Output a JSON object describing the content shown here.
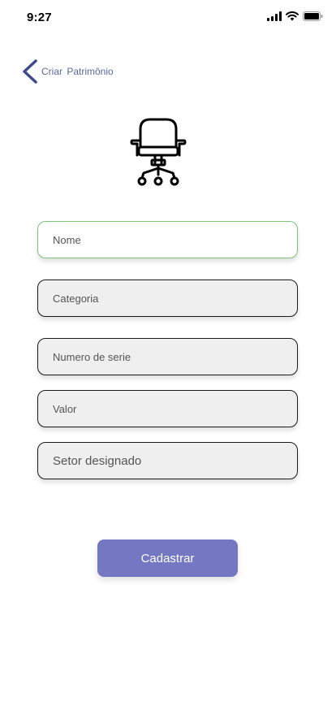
{
  "status_bar": {
    "time": "9:27",
    "icons": [
      "signal-icon",
      "wifi-icon",
      "battery-icon"
    ]
  },
  "header": {
    "back_icon": "chevron-left-icon",
    "title": "Criar  Patrimônio"
  },
  "hero": {
    "icon": "office-chair-icon"
  },
  "form": {
    "fields": [
      {
        "placeholder": "Nome",
        "value": ""
      },
      {
        "placeholder": "Categoria",
        "value": ""
      },
      {
        "placeholder": "Numero de serie",
        "value": ""
      },
      {
        "placeholder": "Valor",
        "value": ""
      },
      {
        "placeholder": "Setor designado",
        "value": ""
      }
    ],
    "submit_label": "Cadastrar"
  },
  "colors": {
    "accent": "#7478c3",
    "title": "#5a67a8",
    "active_border": "#7cc576",
    "field_bg": "#efefef"
  }
}
